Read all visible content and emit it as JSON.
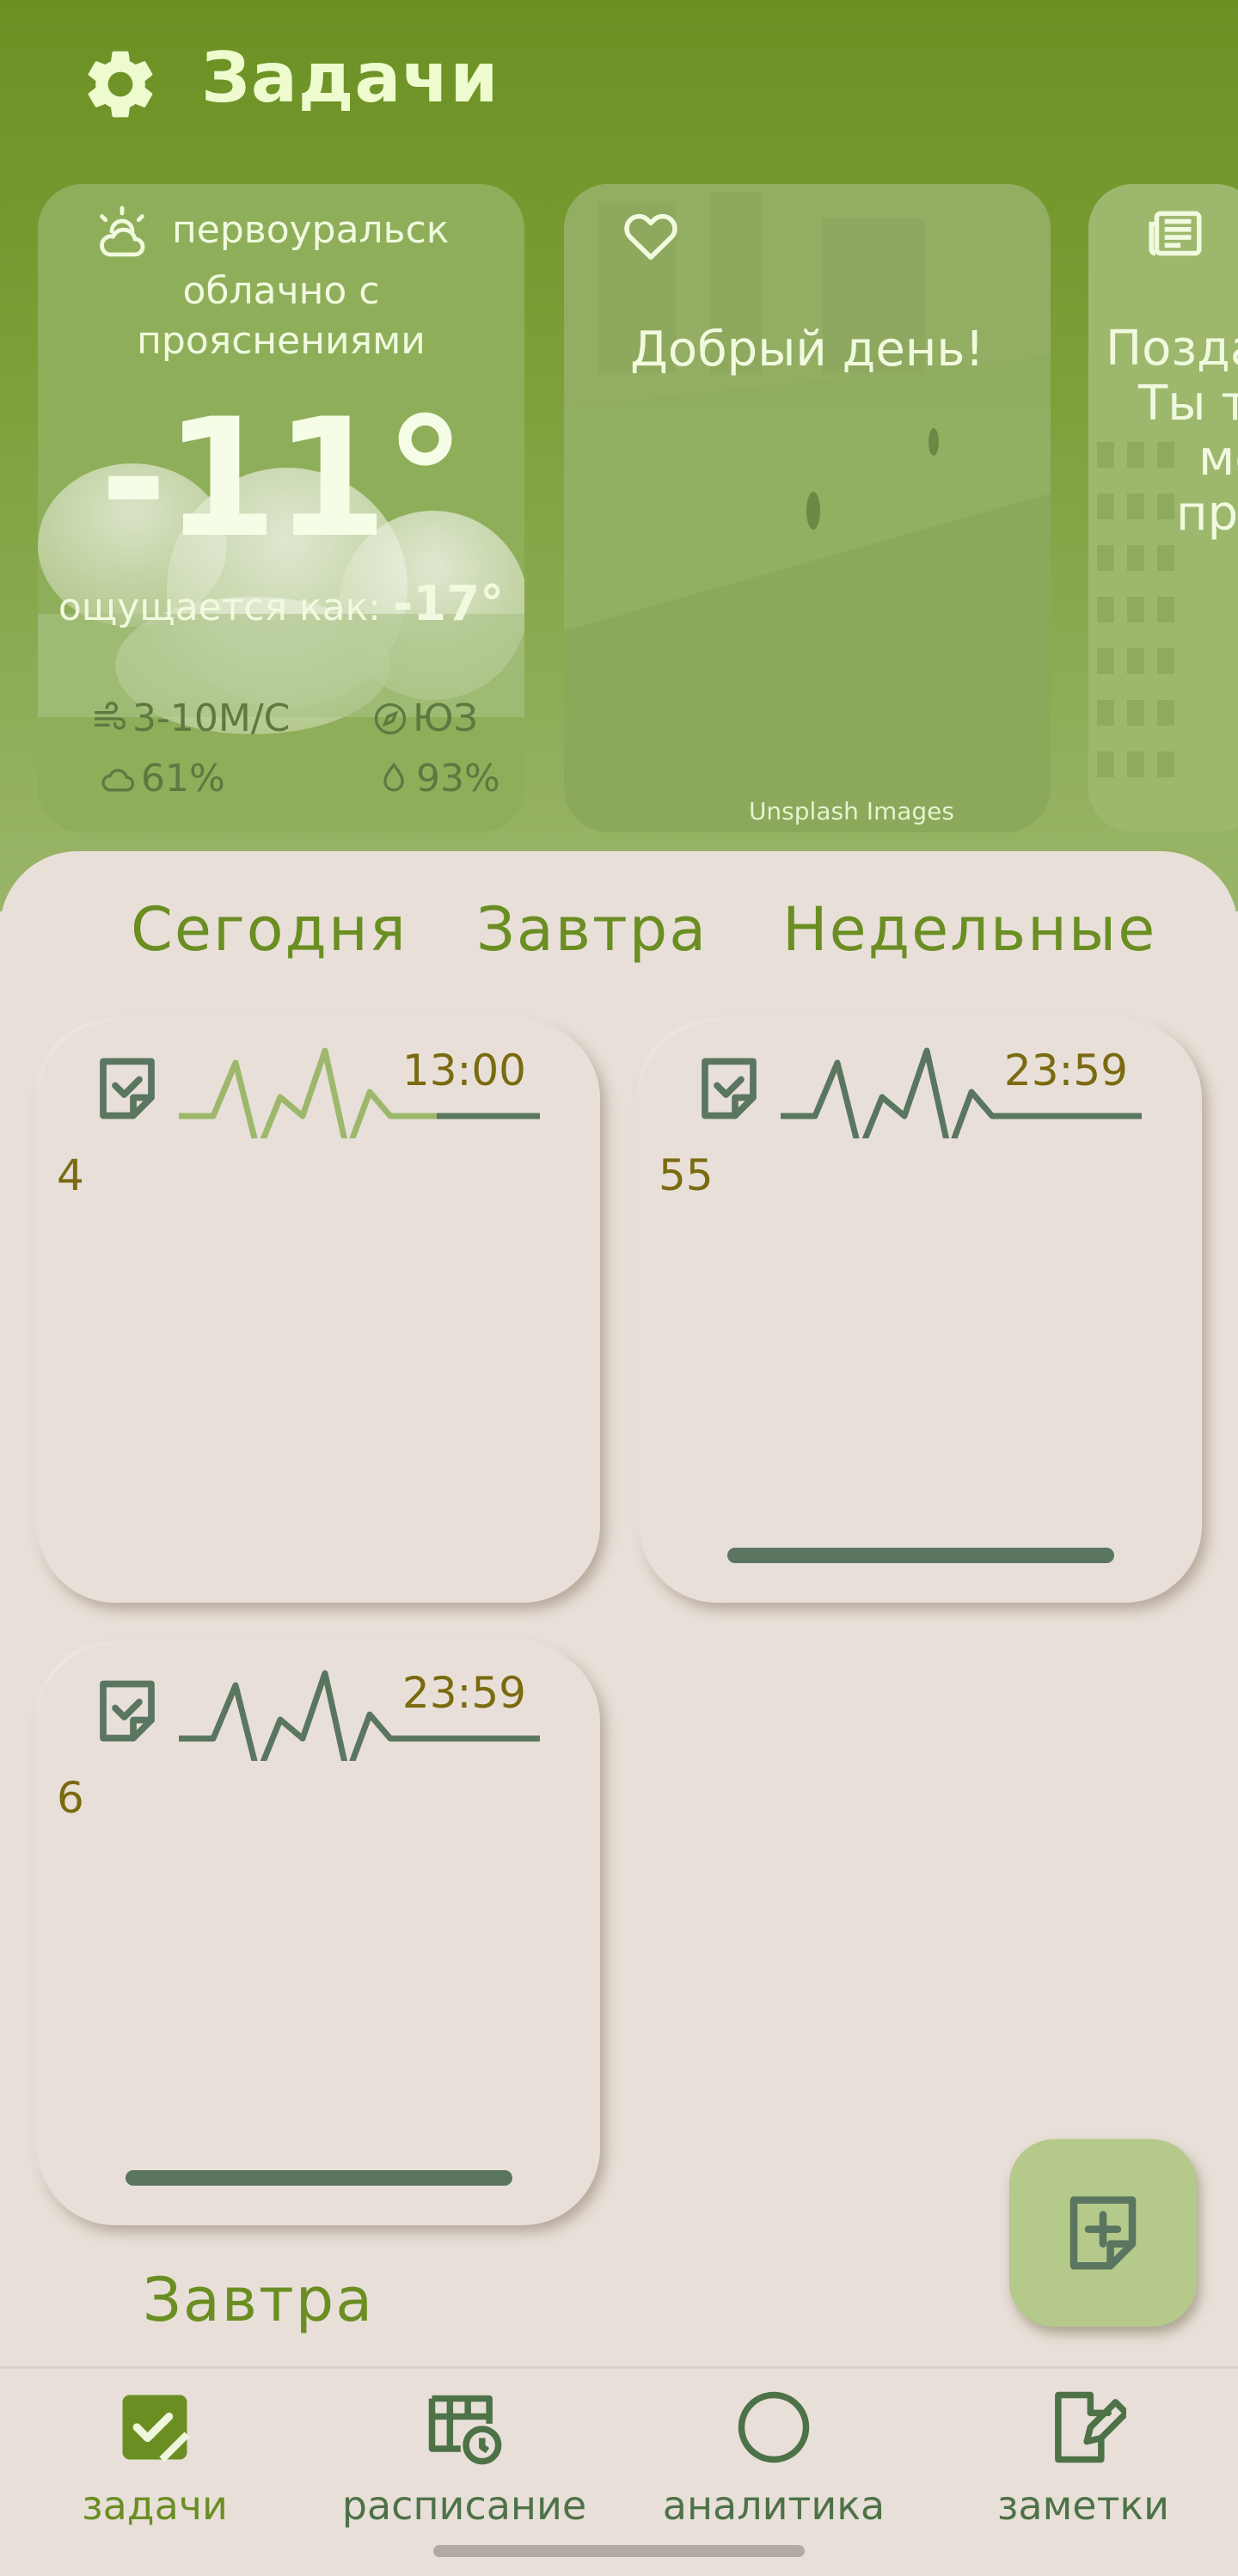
{
  "header": {
    "title": "Задачи",
    "settings_icon": "gear-icon"
  },
  "weather": {
    "city": "первоуральск",
    "condition_line1": "облачно с",
    "condition_line2": "прояснениями",
    "temperature": "-11°",
    "feels_label": "ощущается как:",
    "feels_value": "-17°",
    "wind": "3-10М/С",
    "direction": "ЮЗ",
    "clouds": "61%",
    "humidity": "93%"
  },
  "greeting": {
    "text": "Добрый день!",
    "credit": "Unsplash Images"
  },
  "news": {
    "line1": "Позда",
    "line2": "Ты те",
    "line3": "мо",
    "line4": "при"
  },
  "tabs": [
    {
      "label": "Сегодня"
    },
    {
      "label": "Завтра"
    },
    {
      "label": "Недельные"
    }
  ],
  "tasks": [
    {
      "time": "13:00",
      "count": "4",
      "progress": 0.0
    },
    {
      "time": "23:59",
      "count": "55",
      "progress": 1.0
    },
    {
      "time": "23:59",
      "count": "6",
      "progress": 1.0
    }
  ],
  "section": {
    "label": "Завтра"
  },
  "nav": [
    {
      "label": "задачи",
      "icon": "tasks-icon",
      "active": true
    },
    {
      "label": "расписание",
      "icon": "schedule-icon",
      "active": false
    },
    {
      "label": "аналитика",
      "icon": "analytics-icon",
      "active": false
    },
    {
      "label": "заметки",
      "icon": "notes-icon",
      "active": false
    }
  ],
  "colors": {
    "header_green": "#6b9022",
    "accent_green": "#6b8e23",
    "task_dark": "#5a7560",
    "background": "#e8e0d8",
    "time_text": "#7a6a10"
  }
}
